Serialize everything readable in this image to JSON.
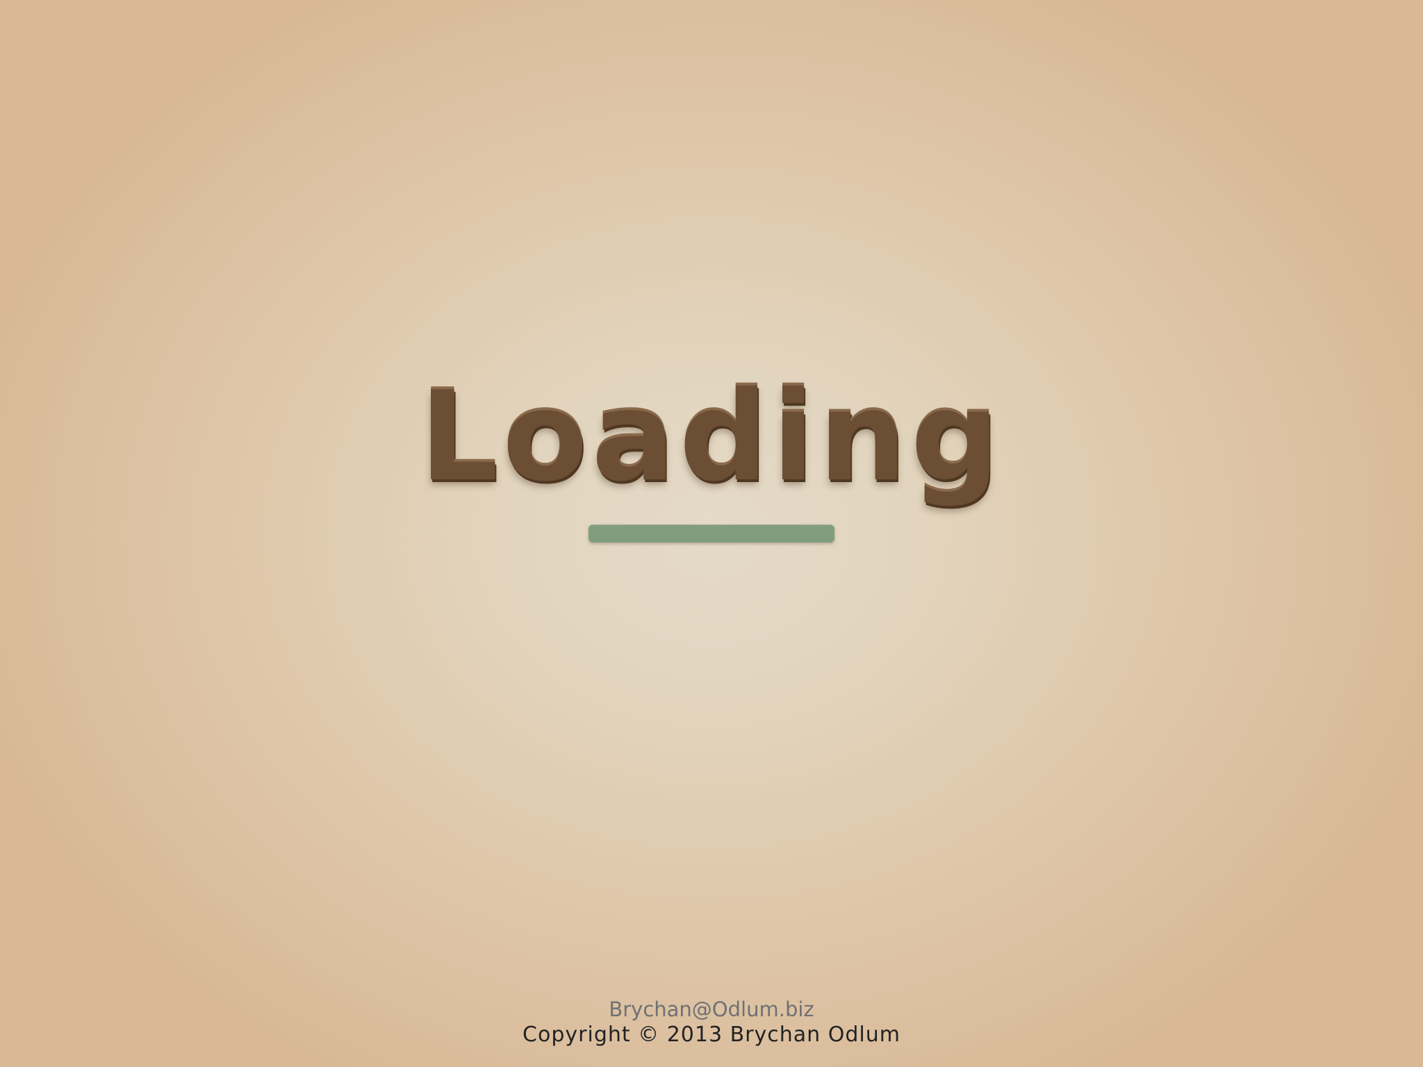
{
  "screen": {
    "title": "Loading"
  },
  "progress": {
    "fraction": 1.0,
    "color": "#829d7d"
  },
  "footer": {
    "email": "Brychan@Odlum.biz",
    "copyright": "Copyright © 2013 Brychan Odlum"
  },
  "colors": {
    "title": "#6b4e33",
    "background_center": "#e5dac8",
    "background_edge": "#d8b896"
  }
}
